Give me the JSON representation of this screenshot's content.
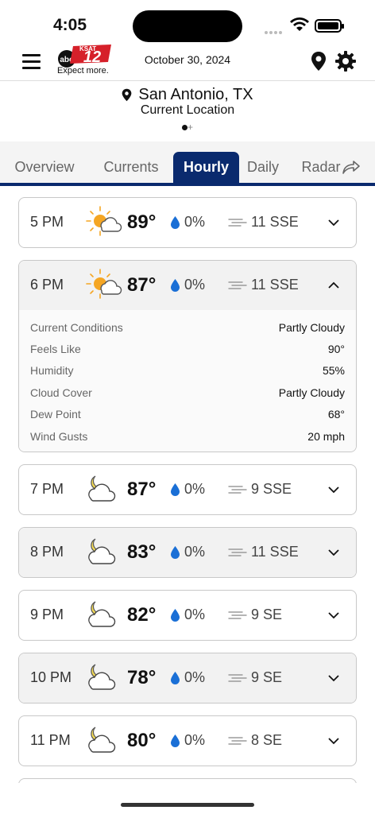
{
  "status_bar": {
    "time": "4:05"
  },
  "header": {
    "brand_channel": "12",
    "brand_name": "KSAT",
    "brand_network": "abc",
    "tagline": "Expect more.",
    "date": "October 30, 2024"
  },
  "location": {
    "name": "San Antonio, TX",
    "subtitle": "Current Location"
  },
  "tabs": [
    {
      "label": "Overview"
    },
    {
      "label": "Currents"
    },
    {
      "label": "Hourly",
      "active": true
    },
    {
      "label": "Daily"
    },
    {
      "label": "Radar"
    }
  ],
  "hourly": [
    {
      "hour": "5 PM",
      "icon": "partly-sunny-icon",
      "temp": "89°",
      "precip": "0%",
      "wind": "11 SSE",
      "expanded": false,
      "shaded": false
    },
    {
      "hour": "6 PM",
      "icon": "partly-sunny-icon",
      "temp": "87°",
      "precip": "0%",
      "wind": "11 SSE",
      "expanded": true,
      "shaded": true,
      "details": [
        {
          "label": "Current Conditions",
          "value": "Partly Cloudy"
        },
        {
          "label": "Feels Like",
          "value": "90°"
        },
        {
          "label": "Humidity",
          "value": "55%"
        },
        {
          "label": "Cloud Cover",
          "value": "Partly Cloudy"
        },
        {
          "label": "Dew Point",
          "value": "68°"
        },
        {
          "label": "Wind Gusts",
          "value": "20 mph"
        }
      ]
    },
    {
      "hour": "7 PM",
      "icon": "partly-cloudy-night-icon",
      "temp": "87°",
      "precip": "0%",
      "wind": "9 SSE",
      "expanded": false,
      "shaded": false
    },
    {
      "hour": "8 PM",
      "icon": "partly-cloudy-night-icon",
      "temp": "83°",
      "precip": "0%",
      "wind": "11 SSE",
      "expanded": false,
      "shaded": true
    },
    {
      "hour": "9 PM",
      "icon": "partly-cloudy-night-icon",
      "temp": "82°",
      "precip": "0%",
      "wind": "9 SE",
      "expanded": false,
      "shaded": false
    },
    {
      "hour": "10 PM",
      "icon": "partly-cloudy-night-icon",
      "temp": "78°",
      "precip": "0%",
      "wind": "9 SE",
      "expanded": false,
      "shaded": true
    },
    {
      "hour": "11 PM",
      "icon": "partly-cloudy-night-icon",
      "temp": "80°",
      "precip": "0%",
      "wind": "8 SE",
      "expanded": false,
      "shaded": false
    }
  ],
  "colors": {
    "brand_navy": "#0a2a6e",
    "brand_red": "#d6202a",
    "sun": "#f5a623",
    "drop": "#1a6fd6"
  }
}
